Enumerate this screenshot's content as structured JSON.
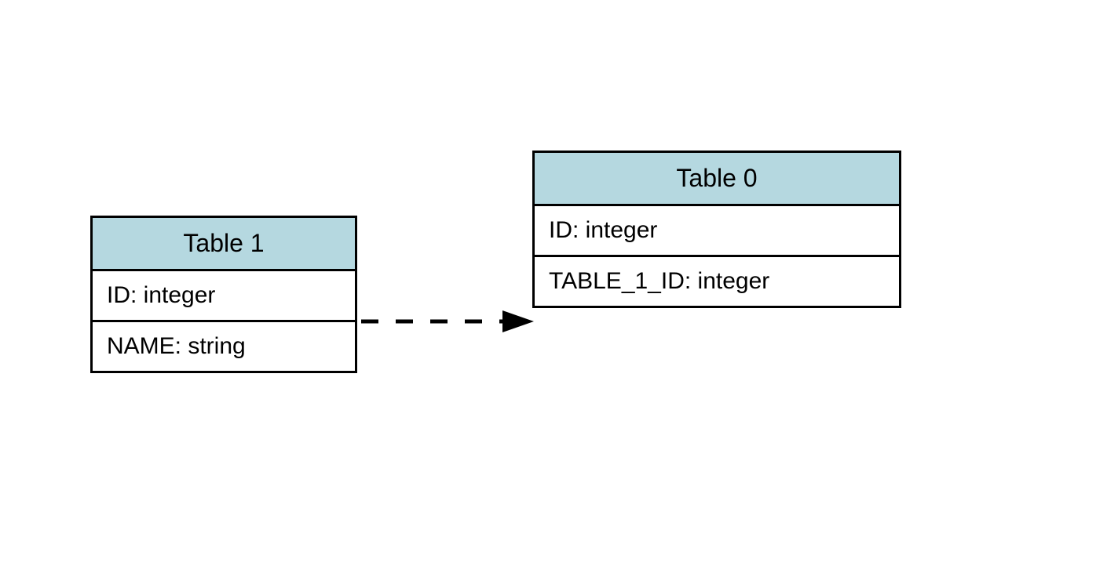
{
  "tables": {
    "table1": {
      "title": "Table 1",
      "rows": [
        "ID: integer",
        "NAME: string"
      ]
    },
    "table0": {
      "title": "Table 0",
      "rows": [
        "ID: integer",
        "TABLE_1_ID: integer"
      ]
    }
  },
  "relationship": {
    "from": "table1.ID",
    "to": "table0.TABLE_1_ID",
    "style": "dashed-arrow"
  },
  "colors": {
    "header_bg": "#b5d8e0",
    "border": "#000000",
    "background": "#ffffff"
  }
}
